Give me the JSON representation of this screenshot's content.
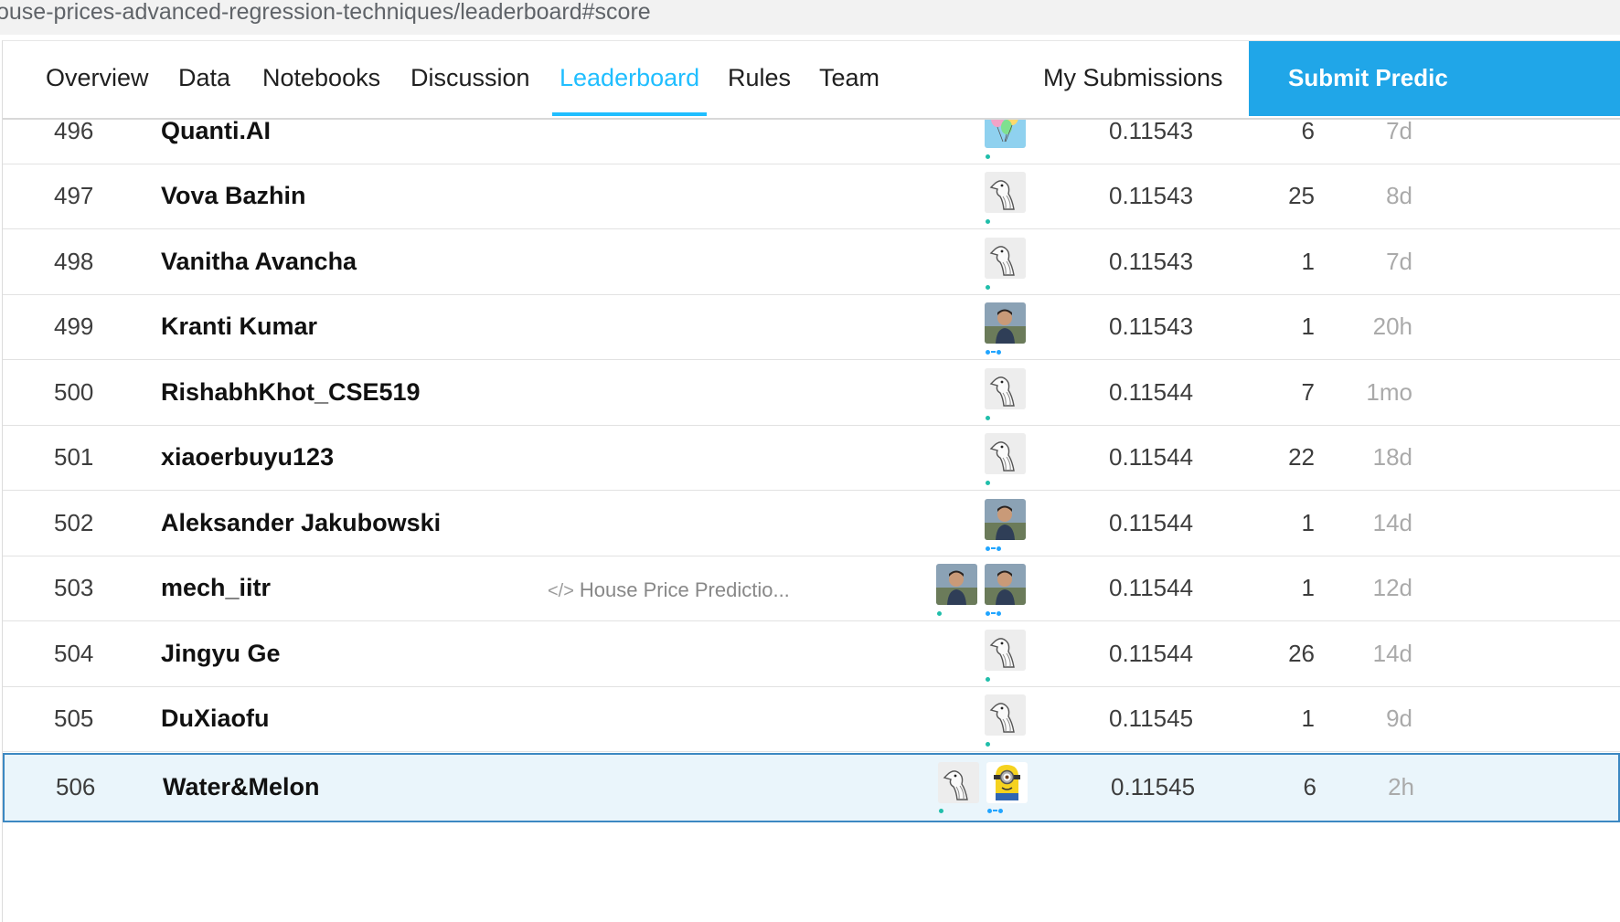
{
  "browser": {
    "url": "ouse-prices-advanced-regression-techniques/leaderboard#score"
  },
  "nav": {
    "tabs": [
      {
        "label": "Overview",
        "active": false
      },
      {
        "label": "Data",
        "active": false
      },
      {
        "label": "Notebooks",
        "active": false
      },
      {
        "label": "Discussion",
        "active": false
      },
      {
        "label": "Leaderboard",
        "active": true
      },
      {
        "label": "Rules",
        "active": false
      },
      {
        "label": "Team",
        "active": false
      }
    ],
    "my_submissions": "My Submissions",
    "submit_button": "Submit Predic"
  },
  "colors": {
    "accent": "#20beff",
    "submit_bg": "#20a6e8",
    "highlight_row": "#eaf5fb",
    "highlight_border": "#3c88c2"
  },
  "leaderboard": {
    "rows": [
      {
        "rank": "496",
        "team": "Quanti.AI",
        "kernel": "",
        "score": "0.11543",
        "entries": "6",
        "last": "7d",
        "avatars": [
          "balloon-avatar"
        ],
        "tiers": [
          "contributor"
        ],
        "current_team": false
      },
      {
        "rank": "497",
        "team": "Vova Bazhin",
        "kernel": "",
        "score": "0.11543",
        "entries": "25",
        "last": "8d",
        "avatars": [
          "default-duck-avatar"
        ],
        "tiers": [
          "contributor"
        ],
        "current_team": false
      },
      {
        "rank": "498",
        "team": "Vanitha Avancha",
        "kernel": "",
        "score": "0.11543",
        "entries": "1",
        "last": "7d",
        "avatars": [
          "default-duck-avatar"
        ],
        "tiers": [
          "contributor"
        ],
        "current_team": false
      },
      {
        "rank": "499",
        "team": "Kranti Kumar",
        "kernel": "",
        "score": "0.11543",
        "entries": "1",
        "last": "20h",
        "avatars": [
          "photo-avatar"
        ],
        "tiers": [
          "expert"
        ],
        "current_team": false
      },
      {
        "rank": "500",
        "team": "RishabhKhot_CSE519",
        "kernel": "",
        "score": "0.11544",
        "entries": "7",
        "last": "1mo",
        "avatars": [
          "default-duck-avatar"
        ],
        "tiers": [
          "contributor"
        ],
        "current_team": false
      },
      {
        "rank": "501",
        "team": "xiaoerbuyu123",
        "kernel": "",
        "score": "0.11544",
        "entries": "22",
        "last": "18d",
        "avatars": [
          "default-duck-avatar"
        ],
        "tiers": [
          "contributor"
        ],
        "current_team": false
      },
      {
        "rank": "502",
        "team": "Aleksander Jakubowski",
        "kernel": "",
        "score": "0.11544",
        "entries": "1",
        "last": "14d",
        "avatars": [
          "photo-avatar"
        ],
        "tiers": [
          "expert"
        ],
        "current_team": false
      },
      {
        "rank": "503",
        "team": "mech_iitr",
        "kernel": "House Price Predictio...",
        "score": "0.11544",
        "entries": "1",
        "last": "12d",
        "avatars": [
          "photo-avatar",
          "photo-avatar"
        ],
        "tiers": [
          "contributor",
          "expert"
        ],
        "current_team": false
      },
      {
        "rank": "504",
        "team": "Jingyu Ge",
        "kernel": "",
        "score": "0.11544",
        "entries": "26",
        "last": "14d",
        "avatars": [
          "default-duck-avatar"
        ],
        "tiers": [
          "contributor"
        ],
        "current_team": false
      },
      {
        "rank": "505",
        "team": "DuXiaofu",
        "kernel": "",
        "score": "0.11545",
        "entries": "1",
        "last": "9d",
        "avatars": [
          "default-duck-avatar"
        ],
        "tiers": [
          "contributor"
        ],
        "current_team": false
      },
      {
        "rank": "506",
        "team": "Water&Melon",
        "kernel": "",
        "score": "0.11545",
        "entries": "6",
        "last": "2h",
        "avatars": [
          "default-duck-avatar",
          "minion-avatar"
        ],
        "tiers": [
          "contributor",
          "expert"
        ],
        "current_team": true
      }
    ]
  }
}
